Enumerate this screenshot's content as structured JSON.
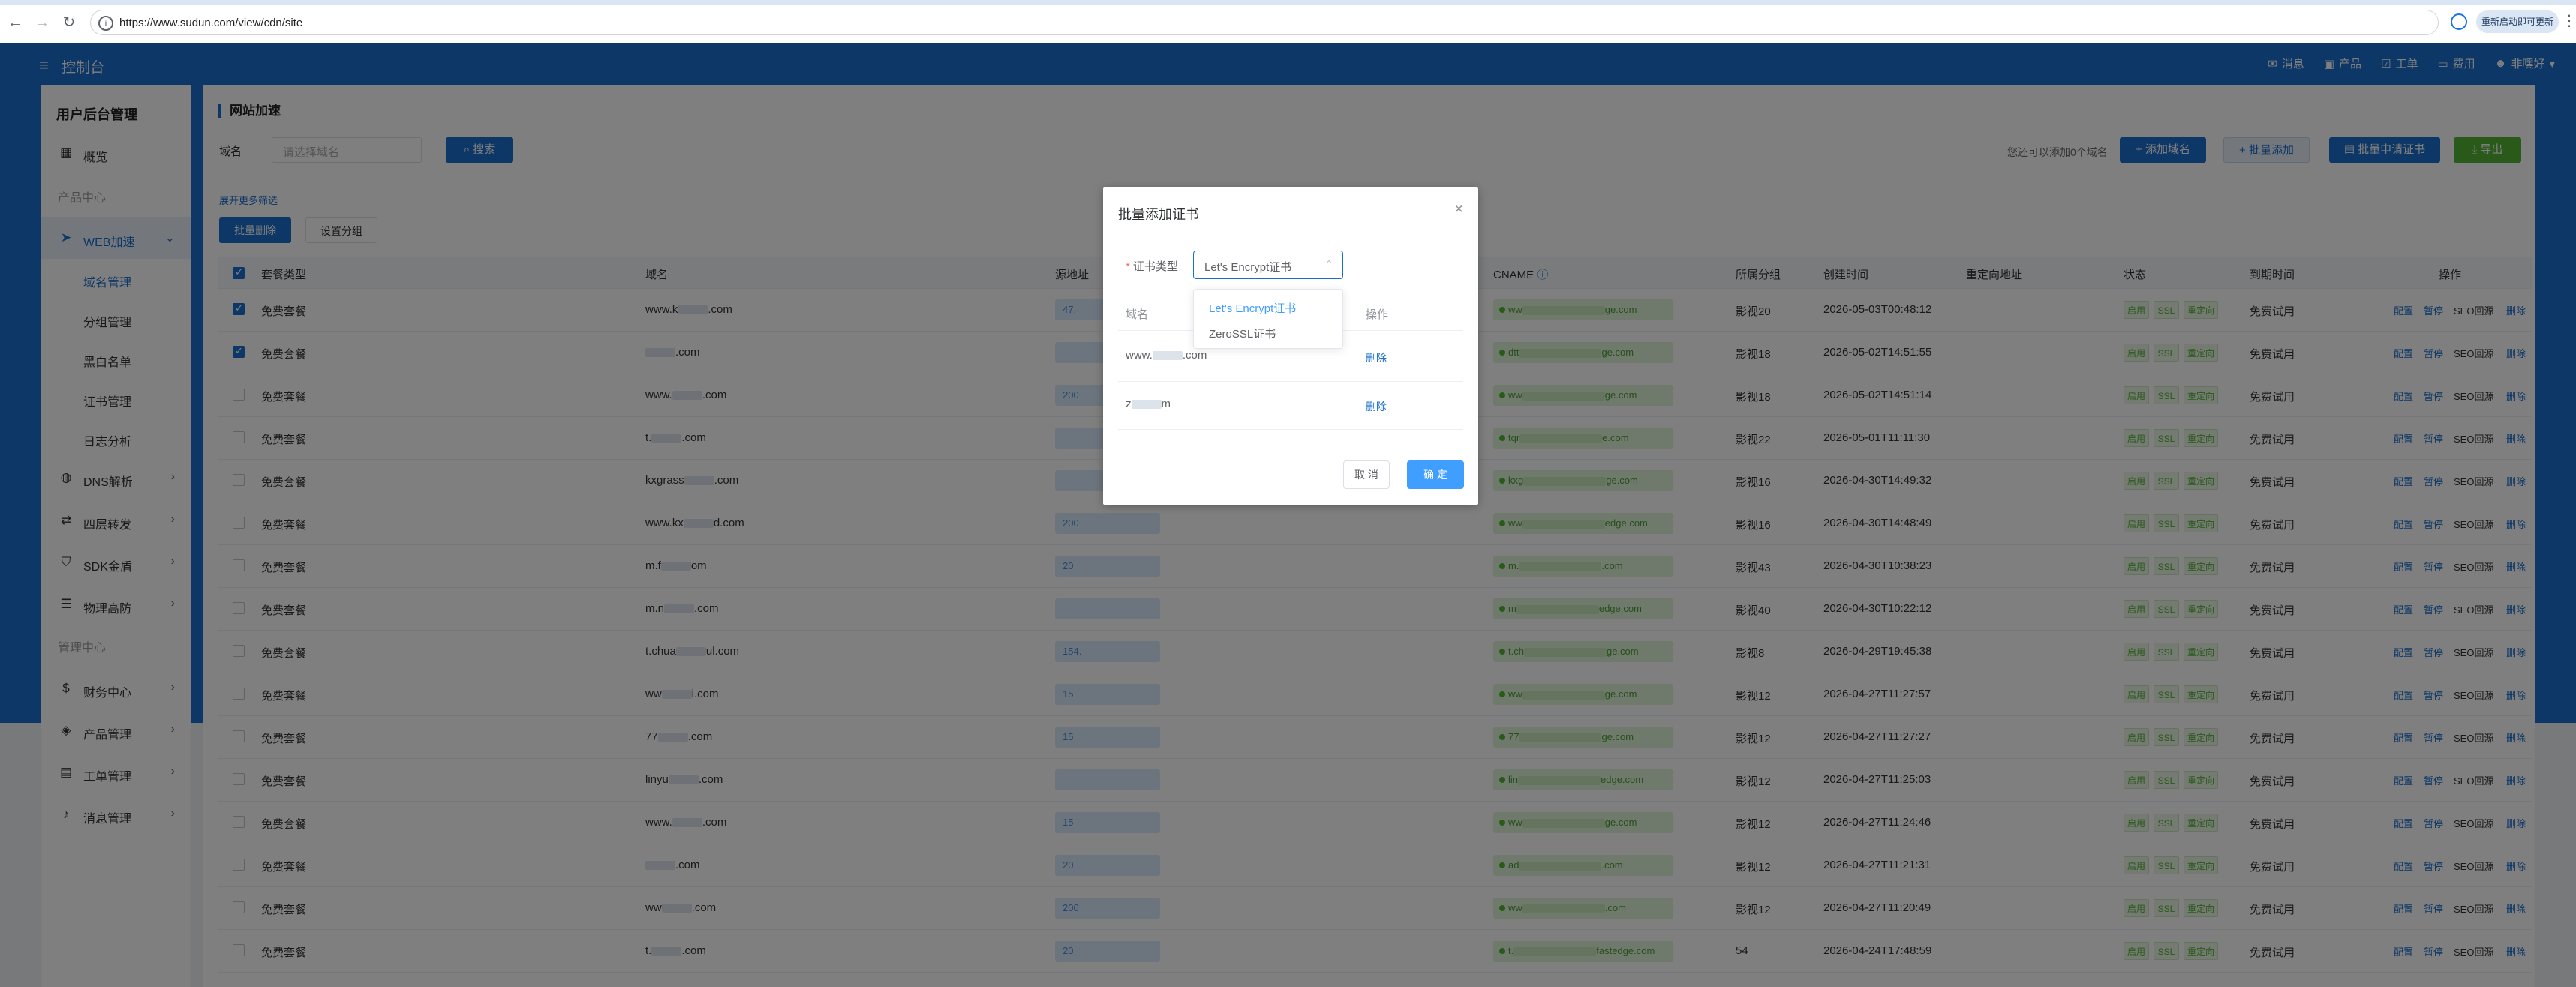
{
  "browser": {
    "url": "https://www.sudun.com/view/cdn/site",
    "update_label": "重新启动即可更新"
  },
  "header": {
    "title": "控制台",
    "links": [
      {
        "icon": "mail-icon",
        "label": "消息"
      },
      {
        "icon": "product-icon",
        "label": "产品"
      },
      {
        "icon": "ticket-icon",
        "label": "工单"
      },
      {
        "icon": "cost-icon",
        "label": "费用"
      },
      {
        "icon": "user-icon",
        "label": "非嘿好"
      }
    ]
  },
  "sidebar": {
    "title": "用户后台管理",
    "overview": "概览",
    "section_product": "产品中心",
    "web_accel": "WEB加速",
    "sub_items": [
      "域名管理",
      "分组管理",
      "黑白名单",
      "证书管理",
      "日志分析"
    ],
    "items": [
      "DNS解析",
      "四层转发",
      "SDK金盾",
      "物理高防"
    ],
    "section_manage": "管理中心",
    "manage_items": [
      "财务中心",
      "产品管理",
      "工单管理",
      "消息管理"
    ]
  },
  "main": {
    "title": "网站加速",
    "filter_label": "域名",
    "filter_placeholder": "请选择域名",
    "search_label": "搜索",
    "remain_text": "您还可以添加0个域名",
    "add_domain": "添加域名",
    "batch_add": "批量添加",
    "batch_cert": "批量申请证书",
    "export": "导出",
    "expand_filter": "展开更多筛选",
    "batch_delete": "批量删除",
    "set_group": "设置分组"
  },
  "table": {
    "headers": [
      "套餐类型",
      "域名",
      "源地址",
      "CNAME",
      "所属分组",
      "创建时间",
      "重定向地址",
      "状态",
      "到期时间",
      "操作"
    ],
    "status_tags": [
      "启用",
      "SSL",
      "重定向"
    ],
    "ops": [
      "配置",
      "暂停",
      "SEO回源",
      "删除"
    ],
    "rows": [
      {
        "plan": "免费套餐",
        "domain_a": "www.k",
        "domain_b": ".com",
        "addr_a": "47.",
        "cname_a": "ww",
        "cname_b": "ge.com",
        "group": "影视20",
        "created": "2026-05-03T00:48:12",
        "expire": "免费试用",
        "checked": true
      },
      {
        "plan": "免费套餐",
        "domain_a": "",
        "domain_b": ".com",
        "addr_a": "",
        "cname_a": "dtt",
        "cname_b": "ge.com",
        "group": "影视18",
        "created": "2026-05-02T14:51:55",
        "expire": "免费试用",
        "checked": true
      },
      {
        "plan": "免费套餐",
        "domain_a": "www.",
        "domain_b": ".com",
        "addr_a": "200",
        "cname_a": "ww",
        "cname_b": "ge.com",
        "group": "影视18",
        "created": "2026-05-02T14:51:14",
        "expire": "免费试用",
        "checked": false
      },
      {
        "plan": "免费套餐",
        "domain_a": "t.",
        "domain_b": ".com",
        "addr_a": "",
        "cname_a": "tqr",
        "cname_b": "e.com",
        "group": "影视22",
        "created": "2026-05-01T11:11:30",
        "expire": "免费试用",
        "checked": false
      },
      {
        "plan": "免费套餐",
        "domain_a": "kxgrass",
        "domain_b": ".com",
        "addr_a": "",
        "cname_a": "kxg",
        "cname_b": "ge.com",
        "group": "影视16",
        "created": "2026-04-30T14:49:32",
        "expire": "免费试用",
        "checked": false
      },
      {
        "plan": "免费套餐",
        "domain_a": "www.kx",
        "domain_b": "d.com",
        "addr_a": "200",
        "cname_a": "ww",
        "cname_b": "edge.com",
        "group": "影视16",
        "created": "2026-04-30T14:48:49",
        "expire": "免费试用",
        "checked": false
      },
      {
        "plan": "免费套餐",
        "domain_a": "m.f",
        "domain_b": "om",
        "addr_a": "20",
        "cname_a": "m.",
        "cname_b": ".com",
        "group": "影视43",
        "created": "2026-04-30T10:38:23",
        "expire": "免费试用",
        "checked": false
      },
      {
        "plan": "免费套餐",
        "domain_a": "m.n",
        "domain_b": ".com",
        "addr_a": "",
        "cname_a": "m",
        "cname_b": "edge.com",
        "group": "影视40",
        "created": "2026-04-30T10:22:12",
        "expire": "免费试用",
        "checked": false
      },
      {
        "plan": "免费套餐",
        "domain_a": "t.chua",
        "domain_b": "ul.com",
        "addr_a": "154.",
        "cname_a": "t.ch",
        "cname_b": "ge.com",
        "group": "影视8",
        "created": "2026-04-29T19:45:38",
        "expire": "免费试用",
        "checked": false
      },
      {
        "plan": "免费套餐",
        "domain_a": "ww",
        "domain_b": "i.com",
        "addr_a": "15",
        "cname_a": "ww",
        "cname_b": "ge.com",
        "group": "影视12",
        "created": "2026-04-27T11:27:57",
        "expire": "免费试用",
        "checked": false
      },
      {
        "plan": "免费套餐",
        "domain_a": "77",
        "domain_b": ".com",
        "addr_a": "15",
        "cname_a": "77",
        "cname_b": "ge.com",
        "group": "影视12",
        "created": "2026-04-27T11:27:27",
        "expire": "免费试用",
        "checked": false
      },
      {
        "plan": "免费套餐",
        "domain_a": "linyu",
        "domain_b": ".com",
        "addr_a": "",
        "cname_a": "lin",
        "cname_b": "edge.com",
        "group": "影视12",
        "created": "2026-04-27T11:25:03",
        "expire": "免费试用",
        "checked": false
      },
      {
        "plan": "免费套餐",
        "domain_a": "www.",
        "domain_b": ".com",
        "addr_a": "15",
        "cname_a": "ww",
        "cname_b": "ge.com",
        "group": "影视12",
        "created": "2026-04-27T11:24:46",
        "expire": "免费试用",
        "checked": false
      },
      {
        "plan": "免费套餐",
        "domain_a": "",
        "domain_b": ".com",
        "addr_a": "20",
        "cname_a": "ad",
        "cname_b": ".com",
        "group": "影视12",
        "created": "2026-04-27T11:21:31",
        "expire": "免费试用",
        "checked": false
      },
      {
        "plan": "免费套餐",
        "domain_a": "ww",
        "domain_b": ".com",
        "addr_a": "200",
        "cname_a": "ww",
        "cname_b": ".com",
        "group": "影视12",
        "created": "2026-04-27T11:20:49",
        "expire": "免费试用",
        "checked": false
      },
      {
        "plan": "免费套餐",
        "domain_a": "t.",
        "domain_b": ".com",
        "addr_a": "20",
        "cname_a": "t.",
        "cname_b": "fastedge.com",
        "group": "54",
        "created": "2026-04-24T17:48:59",
        "expire": "免费试用",
        "checked": false
      }
    ]
  },
  "dialog": {
    "title": "批量添加证书",
    "cert_type_label": "证书类型",
    "cert_type_value": "Let's Encrypt证书",
    "col_domain": "域名",
    "col_op": "操作",
    "rows": [
      {
        "a": "www.",
        "b": ".com"
      },
      {
        "a": "z",
        "b": "m"
      }
    ],
    "delete_label": "删除",
    "cancel_label": "取 消",
    "ok_label": "确 定"
  },
  "dropdown": {
    "options": [
      "Let's Encrypt证书",
      "ZeroSSL证书"
    ],
    "selected": 0
  }
}
